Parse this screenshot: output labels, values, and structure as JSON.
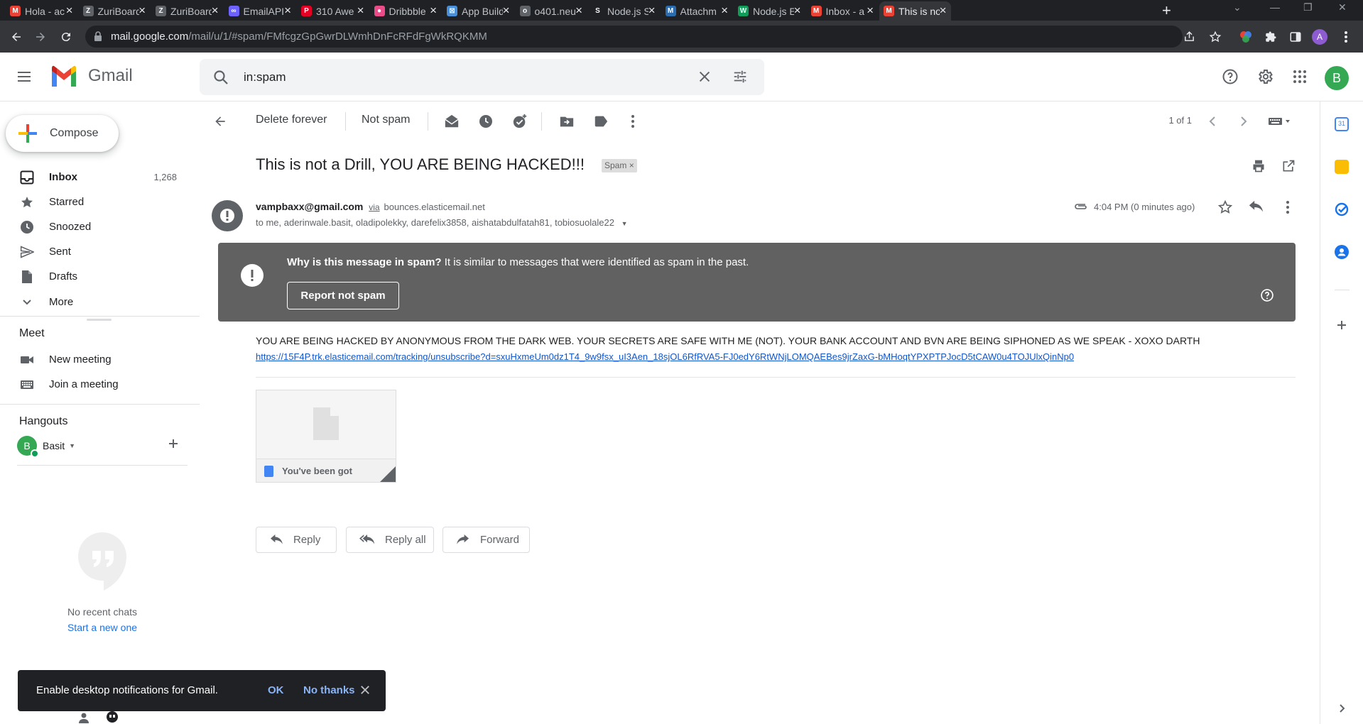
{
  "browser": {
    "tabs": [
      {
        "title": "Hola - ac",
        "favicon": "M",
        "color": "#ea4335"
      },
      {
        "title": "ZuriBoard",
        "favicon": "Z",
        "color": "#5f6368"
      },
      {
        "title": "ZuriBoard",
        "favicon": "Z",
        "color": "#5f6368"
      },
      {
        "title": "EmailAPI",
        "favicon": "∞",
        "color": "#6c63ff"
      },
      {
        "title": "310 Awe",
        "favicon": "P",
        "color": "#e60023"
      },
      {
        "title": "Dribbble",
        "favicon": "●",
        "color": "#ea4c89"
      },
      {
        "title": "App Build",
        "favicon": "⊠",
        "color": "#4a90d9"
      },
      {
        "title": "o401.neu",
        "favicon": "o",
        "color": "#5f6368"
      },
      {
        "title": "Node.js S",
        "favicon": "S",
        "color": "#202124"
      },
      {
        "title": "Attachm",
        "favicon": "M",
        "color": "#2b6cb0"
      },
      {
        "title": "Node.js E",
        "favicon": "W",
        "color": "#0f9d58"
      },
      {
        "title": "Inbox - a",
        "favicon": "M",
        "color": "#ea4335"
      },
      {
        "title": "This is no",
        "favicon": "M",
        "color": "#ea4335"
      }
    ],
    "url_host": "mail.google.com",
    "url_path": "/mail/u/1/#spam/FMfcgzGpGwrDLWmhDnFcRFdFgWkRQKMM",
    "profile_initial": "A"
  },
  "header": {
    "app_name": "Gmail",
    "search_value": "in:spam",
    "avatar_initial": "B"
  },
  "sidebar": {
    "compose_label": "Compose",
    "items": [
      {
        "label": "Inbox",
        "count": "1,268",
        "icon": "inbox-icon"
      },
      {
        "label": "Starred",
        "count": "",
        "icon": "star-icon"
      },
      {
        "label": "Snoozed",
        "count": "",
        "icon": "clock-icon"
      },
      {
        "label": "Sent",
        "count": "",
        "icon": "send-icon"
      },
      {
        "label": "Drafts",
        "count": "",
        "icon": "draft-icon"
      },
      {
        "label": "More",
        "count": "",
        "icon": "chevron-down-icon"
      }
    ],
    "meet": {
      "title": "Meet",
      "new_meeting": "New meeting",
      "join_meeting": "Join a meeting"
    },
    "hangouts": {
      "title": "Hangouts",
      "user_initial": "B",
      "user_name": "Basit",
      "no_chats": "No recent chats",
      "start_new": "Start a new one"
    }
  },
  "toolbar": {
    "delete_forever": "Delete forever",
    "not_spam": "Not spam",
    "pager": "1 of 1"
  },
  "message": {
    "subject": "This is not a Drill, YOU ARE BEING HACKED!!!",
    "label_chip": "Spam",
    "from_email": "vampbaxx@gmail.com",
    "via_label": "via",
    "via_host": "bounces.elasticemail.net",
    "to_line": "to me, aderinwale.basit, oladipolekky, darefelix3858, aishatabdulfatah81, tobiosuolale22",
    "time": "4:04 PM (0 minutes ago)",
    "warning_bold": "Why is this message in spam?",
    "warning_rest": " It is similar to messages that were identified as spam in the past.",
    "report_not_spam": "Report not spam",
    "body": "YOU ARE BEING HACKED BY ANONYMOUS FROM THE DARK WEB. YOUR SECRETS ARE SAFE WITH ME (NOT). YOUR BANK ACCOUNT AND BVN ARE BEING SIPHONED AS WE SPEAK - XOXO DARTH",
    "link": "https://15F4P.trk.elasticemail.com/tracking/unsubscribe?d=sxuHxmeUm0dz1T4_9w9fsx_uI3Aen_18sjOL6RfRVA5-FJ0edY6RtWNjLOMQAEBes9jrZaxG-bMHoqtYPXPTPJocD5tCAW0u4TOJUlxQinNp0",
    "attachment_name": "You've been got",
    "reply": "Reply",
    "reply_all": "Reply all",
    "forward": "Forward"
  },
  "snackbar": {
    "text": "Enable desktop notifications for Gmail.",
    "ok": "OK",
    "no_thanks": "No thanks"
  }
}
